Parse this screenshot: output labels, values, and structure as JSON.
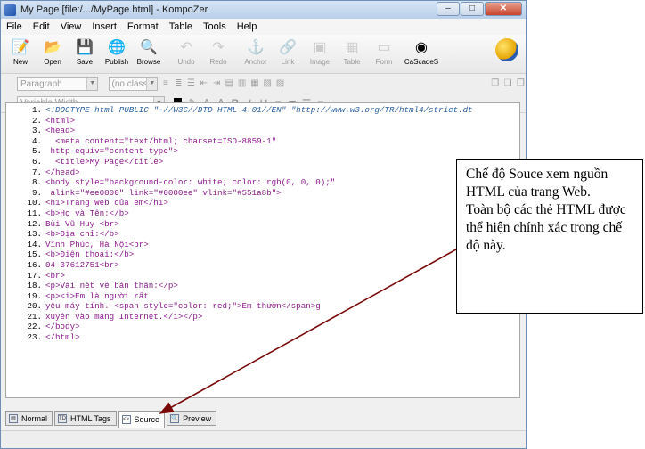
{
  "window": {
    "title": "My Page [file:/.../MyPage.html] - KompoZer"
  },
  "menu": [
    "File",
    "Edit",
    "View",
    "Insert",
    "Format",
    "Table",
    "Tools",
    "Help"
  ],
  "toolbar": [
    {
      "label": "New",
      "icon": "new-icon",
      "disabled": false
    },
    {
      "label": "Open",
      "icon": "open-icon",
      "disabled": false
    },
    {
      "label": "Save",
      "icon": "save-icon",
      "disabled": false
    },
    {
      "label": "Publish",
      "icon": "publish-icon",
      "disabled": false
    },
    {
      "label": "Browse",
      "icon": "browse-icon",
      "disabled": false
    },
    {
      "label": "Undo",
      "icon": "undo-icon",
      "disabled": true
    },
    {
      "label": "Redo",
      "icon": "redo-icon",
      "disabled": true
    },
    {
      "label": "Anchor",
      "icon": "anchor-icon",
      "disabled": true
    },
    {
      "label": "Link",
      "icon": "link-icon",
      "disabled": true
    },
    {
      "label": "Image",
      "icon": "image-icon",
      "disabled": true
    },
    {
      "label": "Table",
      "icon": "table-icon",
      "disabled": true
    },
    {
      "label": "Form",
      "icon": "form-icon",
      "disabled": true
    },
    {
      "label": "CaScadeS",
      "icon": "cascades-icon",
      "disabled": false
    }
  ],
  "format": {
    "paragraph": "Paragraph",
    "class": "(no class)",
    "width": "Variable Width"
  },
  "code_lines": [
    {
      "n": "1.",
      "text": "<!DOCTYPE html PUBLIC \"-//W3C//DTD HTML 4.01//EN\" \"http://www.w3.org/TR/html4/strict.dt",
      "kind": "doc"
    },
    {
      "n": "2.",
      "text": "<html>",
      "kind": "tag"
    },
    {
      "n": "3.",
      "text": "<head>",
      "kind": "tag"
    },
    {
      "n": "4.",
      "text": "  <meta content=\"text/html; charset=ISO-8859-1\"",
      "kind": "tag"
    },
    {
      "n": "5.",
      "text": " http-equiv=\"content-type\">",
      "kind": "tag"
    },
    {
      "n": "6.",
      "text": "  <title>My Page</title>",
      "kind": "tag"
    },
    {
      "n": "7.",
      "text": "</head>",
      "kind": "tag"
    },
    {
      "n": "8.",
      "text": "<body style=\"background-color: white; color: rgb(0, 0, 0);\"",
      "kind": "tag"
    },
    {
      "n": "9.",
      "text": " alink=\"#ee0000\" link=\"#0000ee\" vlink=\"#551a8b\">",
      "kind": "tag"
    },
    {
      "n": "10.",
      "text": "<h1>Trang Web của em</h1>",
      "kind": "tag"
    },
    {
      "n": "11.",
      "text": "<b>Họ và Tên:</b>",
      "kind": "tag"
    },
    {
      "n": "12.",
      "text": "Bùi Vũ Huy <br>",
      "kind": "tag"
    },
    {
      "n": "13.",
      "text": "<b>Địa chỉ:</b>",
      "kind": "tag"
    },
    {
      "n": "14.",
      "text": "Vĩnh Phúc, Hà Nội<br>",
      "kind": "tag"
    },
    {
      "n": "15.",
      "text": "<b>Điện thoại:</b>",
      "kind": "tag"
    },
    {
      "n": "16.",
      "text": "04-37612751<br>",
      "kind": "tag"
    },
    {
      "n": "17.",
      "text": "<br>",
      "kind": "tag"
    },
    {
      "n": "18.",
      "text": "<p>Vài nét về bản thân:</p>",
      "kind": "tag"
    },
    {
      "n": "19.",
      "text": "<p><i>Em là người rất",
      "kind": "tag"
    },
    {
      "n": "20.",
      "text": "yêu máy tính. <span style=\"color: red;\">Em thườn</span>g",
      "kind": "tag"
    },
    {
      "n": "21.",
      "text": "xuyên vào mạng Internet.</i></p>",
      "kind": "tag"
    },
    {
      "n": "22.",
      "text": "</body>",
      "kind": "tag"
    },
    {
      "n": "23.",
      "text": "</html>",
      "kind": "tag"
    }
  ],
  "tabs": [
    {
      "label": "Normal",
      "icon": "normal-tab-icon"
    },
    {
      "label": "HTML Tags",
      "icon": "html-tags-icon"
    },
    {
      "label": "Source",
      "icon": "source-icon",
      "active": true
    },
    {
      "label": "Preview",
      "icon": "preview-icon"
    }
  ],
  "callout": {
    "text": "Chế độ Souce xem nguồn HTML của trang Web.\nToàn bộ các thẻ HTML được thể hiện chính xác trong chế độ này."
  },
  "colors": {
    "tag": "#8b1a8b",
    "doctype": "#2a5f9e",
    "arrow": "#7a0a0a"
  }
}
